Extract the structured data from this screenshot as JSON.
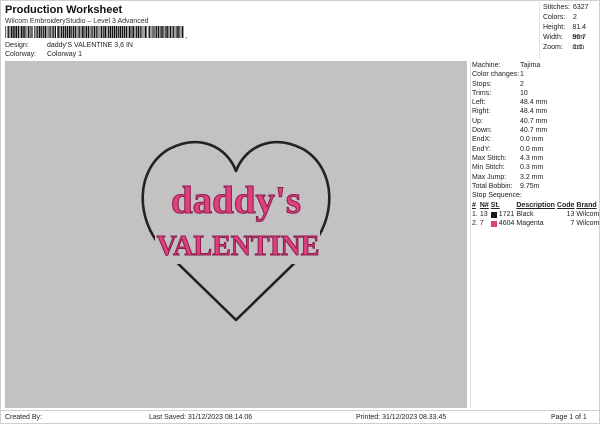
{
  "header": {
    "title": "Production Worksheet",
    "software": "Wilcom EmbroideryStudio – Level 3 Advanced",
    "barcode_suffix": ",",
    "design_label": "Design:",
    "design_value": "daddy'S VALENTINE 3,6 IN",
    "colorway_label": "Colorway:",
    "colorway_value": "Colorway 1"
  },
  "stats": [
    {
      "label": "Stitches:",
      "value": "6327"
    },
    {
      "label": "Colors:",
      "value": "2"
    },
    {
      "label": "Height:",
      "value": "81.4 mm"
    },
    {
      "label": "Width:",
      "value": "96.7 mm"
    },
    {
      "label": "Zoom:",
      "value": "1:1"
    }
  ],
  "design": {
    "line1": "daddy's",
    "line2": "VALENTINE",
    "text_color": "#e0407f",
    "outline_color": "#222222",
    "canvas_color": "#c2c2c2"
  },
  "details": [
    {
      "label": "Machine:",
      "value": "Tajima"
    },
    {
      "label": "Color changes:",
      "value": "1"
    },
    {
      "label": "Stops:",
      "value": "2"
    },
    {
      "label": "Trims:",
      "value": "10"
    },
    {
      "label": "Left:",
      "value": "48.4 mm"
    },
    {
      "label": "Right:",
      "value": "48.4 mm"
    },
    {
      "label": "Up:",
      "value": "40.7 mm"
    },
    {
      "label": "Down:",
      "value": "40.7 mm"
    },
    {
      "label": "EndX:",
      "value": "0.0 mm"
    },
    {
      "label": "EndY:",
      "value": "0.0 mm"
    },
    {
      "label": "Max Stitch:",
      "value": "4.3 mm"
    },
    {
      "label": "Min Stitch:",
      "value": "0.3 mm"
    },
    {
      "label": "Max Jump:",
      "value": "3.2 mm"
    },
    {
      "label": "Total Bobbin:",
      "value": "9.75m"
    }
  ],
  "stop_sequence": {
    "title": "Stop Sequence:",
    "columns": [
      "#",
      "N#",
      "St.",
      "Description",
      "Code",
      "Brand"
    ],
    "rows": [
      {
        "num": "1.",
        "n": "13",
        "color": "#1a1a1a",
        "st": "1721",
        "description": "Black",
        "code": "13",
        "brand": "Wilcom"
      },
      {
        "num": "2.",
        "n": "7",
        "color": "#e0407f",
        "st": "4604",
        "description": "Magenta",
        "code": "7",
        "brand": "Wilcom"
      }
    ]
  },
  "footer": {
    "created_by": "Created By:",
    "last_saved": "Last Saved: 31/12/2023 08.14.06",
    "printed": "Printed: 31/12/2023 08.33.45",
    "page": "Page 1 of 1"
  }
}
